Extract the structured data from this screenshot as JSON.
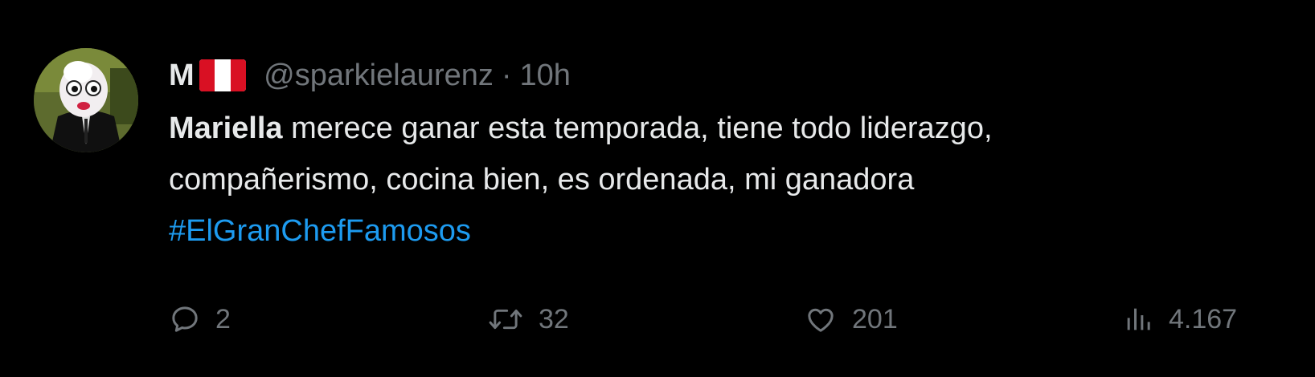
{
  "tweet": {
    "display_name": "M",
    "handle": "@sparkielaurenz",
    "separator": "·",
    "time": "10h",
    "body": {
      "bold_lead": "Mariella",
      "line_1_rest": " merece ganar esta temporada, tiene todo liderazgo,",
      "line_2": "compañerismo, cocina bien, es ordenada, mi ganadora",
      "hashtag": "#ElGranChefFamosos"
    },
    "actions": {
      "reply_count": "2",
      "retweet_count": "32",
      "like_count": "201",
      "views_count": "4.167"
    }
  },
  "icons": {
    "flag": "peru-flag-icon",
    "reply": "reply-icon",
    "retweet": "retweet-icon",
    "like": "heart-icon",
    "views": "views-chart-icon"
  },
  "colors": {
    "background": "#000000",
    "text": "#e7e9ea",
    "muted": "#71767b",
    "link": "#1d9bf0",
    "flag_red": "#d91023"
  }
}
